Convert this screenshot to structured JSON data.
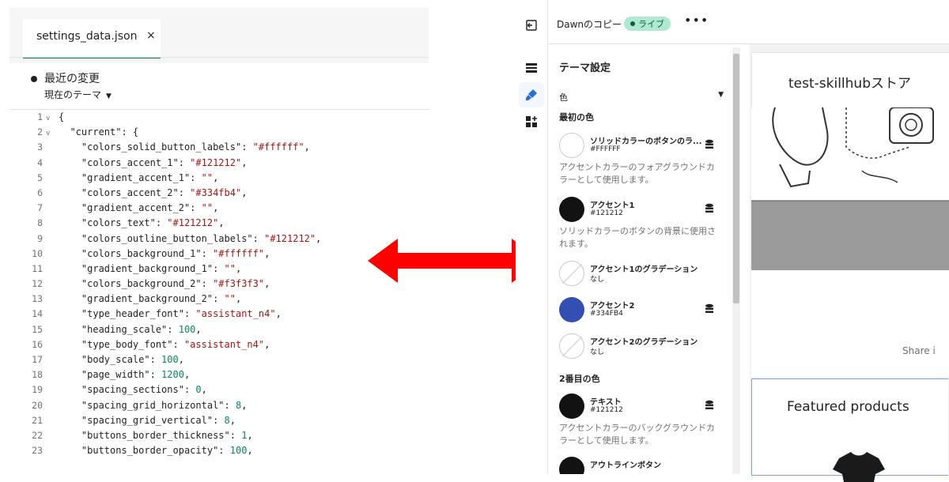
{
  "editor": {
    "tab_label": "settings_data.json",
    "tab_close": "×",
    "changes_title": "最近の変更",
    "theme_select": "現在のテーマ",
    "lines": [
      {
        "n": "1",
        "fold": "v",
        "seg": [
          [
            "p",
            "{"
          ]
        ]
      },
      {
        "n": "2",
        "fold": "v",
        "seg": [
          [
            "k",
            "  \"current\""
          ],
          [
            "p",
            ": {"
          ]
        ]
      },
      {
        "n": "3",
        "seg": [
          [
            "k",
            "    \"colors_solid_button_labels\""
          ],
          [
            "p",
            ": "
          ],
          [
            "s",
            "\"#ffffff\""
          ],
          [
            "p",
            ","
          ]
        ]
      },
      {
        "n": "4",
        "seg": [
          [
            "k",
            "    \"colors_accent_1\""
          ],
          [
            "p",
            ": "
          ],
          [
            "s",
            "\"#121212\""
          ],
          [
            "p",
            ","
          ]
        ]
      },
      {
        "n": "5",
        "seg": [
          [
            "k",
            "    \"gradient_accent_1\""
          ],
          [
            "p",
            ": "
          ],
          [
            "s",
            "\"\""
          ],
          [
            "p",
            ","
          ]
        ]
      },
      {
        "n": "6",
        "seg": [
          [
            "k",
            "    \"colors_accent_2\""
          ],
          [
            "p",
            ": "
          ],
          [
            "s",
            "\"#334fb4\""
          ],
          [
            "p",
            ","
          ]
        ]
      },
      {
        "n": "7",
        "seg": [
          [
            "k",
            "    \"gradient_accent_2\""
          ],
          [
            "p",
            ": "
          ],
          [
            "s",
            "\"\""
          ],
          [
            "p",
            ","
          ]
        ]
      },
      {
        "n": "8",
        "seg": [
          [
            "k",
            "    \"colors_text\""
          ],
          [
            "p",
            ": "
          ],
          [
            "s",
            "\"#121212\""
          ],
          [
            "p",
            ","
          ]
        ]
      },
      {
        "n": "9",
        "seg": [
          [
            "k",
            "    \"colors_outline_button_labels\""
          ],
          [
            "p",
            ": "
          ],
          [
            "s",
            "\"#121212\""
          ],
          [
            "p",
            ","
          ]
        ]
      },
      {
        "n": "10",
        "seg": [
          [
            "k",
            "    \"colors_background_1\""
          ],
          [
            "p",
            ": "
          ],
          [
            "s",
            "\"#ffffff\""
          ],
          [
            "p",
            ","
          ]
        ]
      },
      {
        "n": "11",
        "seg": [
          [
            "k",
            "    \"gradient_background_1\""
          ],
          [
            "p",
            ": "
          ],
          [
            "s",
            "\"\""
          ],
          [
            "p",
            ","
          ]
        ]
      },
      {
        "n": "12",
        "seg": [
          [
            "k",
            "    \"colors_background_2\""
          ],
          [
            "p",
            ": "
          ],
          [
            "s",
            "\"#f3f3f3\""
          ],
          [
            "p",
            ","
          ]
        ]
      },
      {
        "n": "13",
        "seg": [
          [
            "k",
            "    \"gradient_background_2\""
          ],
          [
            "p",
            ": "
          ],
          [
            "s",
            "\"\""
          ],
          [
            "p",
            ","
          ]
        ]
      },
      {
        "n": "14",
        "seg": [
          [
            "k",
            "    \"type_header_font\""
          ],
          [
            "p",
            ": "
          ],
          [
            "s",
            "\"assistant_n4\""
          ],
          [
            "p",
            ","
          ]
        ]
      },
      {
        "n": "15",
        "seg": [
          [
            "k",
            "    \"heading_scale\""
          ],
          [
            "p",
            ": "
          ],
          [
            "n",
            "100"
          ],
          [
            "p",
            ","
          ]
        ]
      },
      {
        "n": "16",
        "seg": [
          [
            "k",
            "    \"type_body_font\""
          ],
          [
            "p",
            ": "
          ],
          [
            "s",
            "\"assistant_n4\""
          ],
          [
            "p",
            ","
          ]
        ]
      },
      {
        "n": "17",
        "seg": [
          [
            "k",
            "    \"body_scale\""
          ],
          [
            "p",
            ": "
          ],
          [
            "n",
            "100"
          ],
          [
            "p",
            ","
          ]
        ]
      },
      {
        "n": "18",
        "seg": [
          [
            "k",
            "    \"page_width\""
          ],
          [
            "p",
            ": "
          ],
          [
            "n",
            "1200"
          ],
          [
            "p",
            ","
          ]
        ]
      },
      {
        "n": "19",
        "seg": [
          [
            "k",
            "    \"spacing_sections\""
          ],
          [
            "p",
            ": "
          ],
          [
            "n",
            "0"
          ],
          [
            "p",
            ","
          ]
        ]
      },
      {
        "n": "20",
        "seg": [
          [
            "k",
            "    \"spacing_grid_horizontal\""
          ],
          [
            "p",
            ": "
          ],
          [
            "n",
            "8"
          ],
          [
            "p",
            ","
          ]
        ]
      },
      {
        "n": "21",
        "seg": [
          [
            "k",
            "    \"spacing_grid_vertical\""
          ],
          [
            "p",
            ": "
          ],
          [
            "n",
            "8"
          ],
          [
            "p",
            ","
          ]
        ]
      },
      {
        "n": "22",
        "seg": [
          [
            "k",
            "    \"buttons_border_thickness\""
          ],
          [
            "p",
            ": "
          ],
          [
            "n",
            "1"
          ],
          [
            "p",
            ","
          ]
        ]
      },
      {
        "n": "23",
        "seg": [
          [
            "k",
            "    \"buttons_border_opacity\""
          ],
          [
            "p",
            ": "
          ],
          [
            "n",
            "100"
          ],
          [
            "p",
            ","
          ]
        ]
      }
    ]
  },
  "arrow": {
    "color": "#ff0000"
  },
  "customizer": {
    "theme_name": "Dawnのコピー",
    "live_badge": "ライブ",
    "more": "•••",
    "panel_title": "テーマ設定",
    "section": "色",
    "group1": "最初の色",
    "group2": "2番目の色",
    "swatches": [
      {
        "name": "ソリッドカラーのボタンのラ...",
        "value": "#FFFFFF",
        "color": "#ffffff"
      },
      {
        "name": "アクセント1",
        "value": "#121212",
        "color": "#121212"
      },
      {
        "name": "アクセント1のグラデーション",
        "value": "なし",
        "color": "none"
      },
      {
        "name": "アクセント2",
        "value": "#334FB4",
        "color": "#334fb4"
      },
      {
        "name": "アクセント2のグラデーション",
        "value": "なし",
        "color": "none"
      },
      {
        "name": "テキスト",
        "value": "#121212",
        "color": "#121212"
      },
      {
        "name": "アウトラインボタン",
        "value": "",
        "color": "#121212"
      }
    ],
    "desc_solid": "アクセントカラーのフォアグラウンドカラーとして使用します。",
    "desc_accent1": "ソリッドカラーのボタンの背景に使用されます。",
    "desc_text": "アクセントカラーのバックグラウンドカラーとして使用します。",
    "preview": {
      "store_name": "test-skillhubストア",
      "share": "Share i",
      "featured": "Featured products"
    }
  }
}
